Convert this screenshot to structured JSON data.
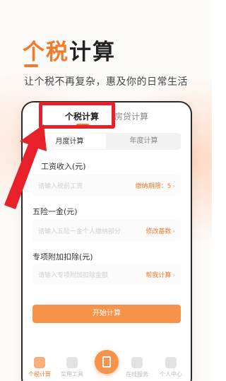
{
  "hero": {
    "title_accent": "个税",
    "title_rest": "计算",
    "subtitle": "让个税不再复杂，惠及你的日常生活"
  },
  "top_tabs": [
    {
      "label": "个税计算",
      "active": true
    },
    {
      "label": "房贷计算",
      "active": false
    }
  ],
  "mode_tabs": [
    {
      "label": "月度计算",
      "active": true
    },
    {
      "label": "年度计算",
      "active": false
    }
  ],
  "fields": {
    "salary": {
      "label": "工资收入(元)",
      "placeholder": "请输入税前工资",
      "action": "缴纳期限：5"
    },
    "insurance": {
      "label": "五险一金(元)",
      "placeholder": "请输入五险一金个人缴纳部分",
      "action": "修改基数"
    },
    "deduction": {
      "label": "专项附加扣除(元)",
      "placeholder": "请输入专项附加扣除金额",
      "action": "帮我计算"
    }
  },
  "start_button": "开始计算",
  "bottom_nav": [
    {
      "label": "个税计算",
      "icon": "tax-icon",
      "active": true
    },
    {
      "label": "实用工具",
      "icon": "tools-icon",
      "active": false
    },
    {
      "label": "",
      "icon": "calculator-icon",
      "active": false
    },
    {
      "label": "在线服务",
      "icon": "service-icon",
      "active": false
    },
    {
      "label": "个人中心",
      "icon": "profile-icon",
      "active": false
    }
  ],
  "colors": {
    "accent": "#f47a2a",
    "button": "#f7924a",
    "highlight": "#e8202a"
  }
}
